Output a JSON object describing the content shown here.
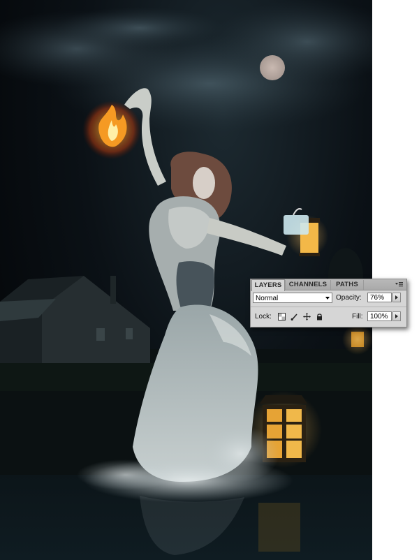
{
  "layers_panel": {
    "tabs": [
      {
        "label": "LAYERS",
        "active": true
      },
      {
        "label": "CHANNELS",
        "active": false
      },
      {
        "label": "PATHS",
        "active": false
      }
    ],
    "blend_mode": "Normal",
    "opacity_label": "Opacity:",
    "opacity_value": "76%",
    "lock_label": "Lock:",
    "fill_label": "Fill:",
    "fill_value": "100%",
    "lock_icons": [
      "lock-transparent-pixels-icon",
      "lock-image-pixels-icon",
      "lock-position-icon",
      "lock-all-icon"
    ],
    "menu_icon": "panel-menu-icon"
  },
  "artwork": {
    "description_icons": [
      "moon",
      "fire",
      "lantern",
      "house",
      "woman"
    ]
  }
}
